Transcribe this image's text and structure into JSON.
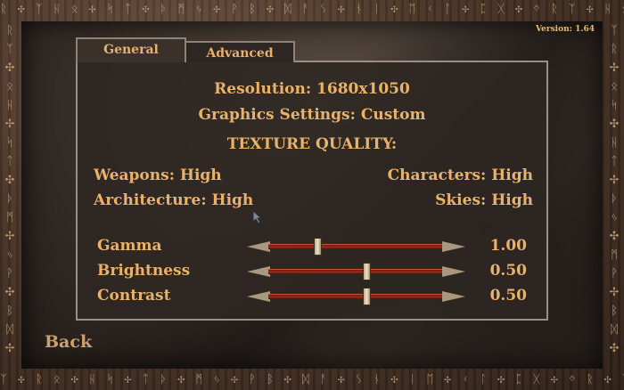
{
  "version": "Version: 1.64",
  "tabs": {
    "general": "General",
    "advanced": "Advanced"
  },
  "resolution": "Resolution: 1680x1050",
  "graphics_settings": "Graphics Settings: Custom",
  "texture_quality_header": "TEXTURE QUALITY:",
  "texture": {
    "weapons": "Weapons: High",
    "characters": "Characters: High",
    "architecture": "Architecture: High",
    "skies": "Skies: High"
  },
  "sliders": [
    {
      "label": "Gamma",
      "value_text": "1.00",
      "level": 0.28
    },
    {
      "label": "Brightness",
      "value_text": "0.50",
      "level": 0.56
    },
    {
      "label": "Contrast",
      "value_text": "0.50",
      "level": 0.56
    }
  ],
  "back_label": "Back"
}
